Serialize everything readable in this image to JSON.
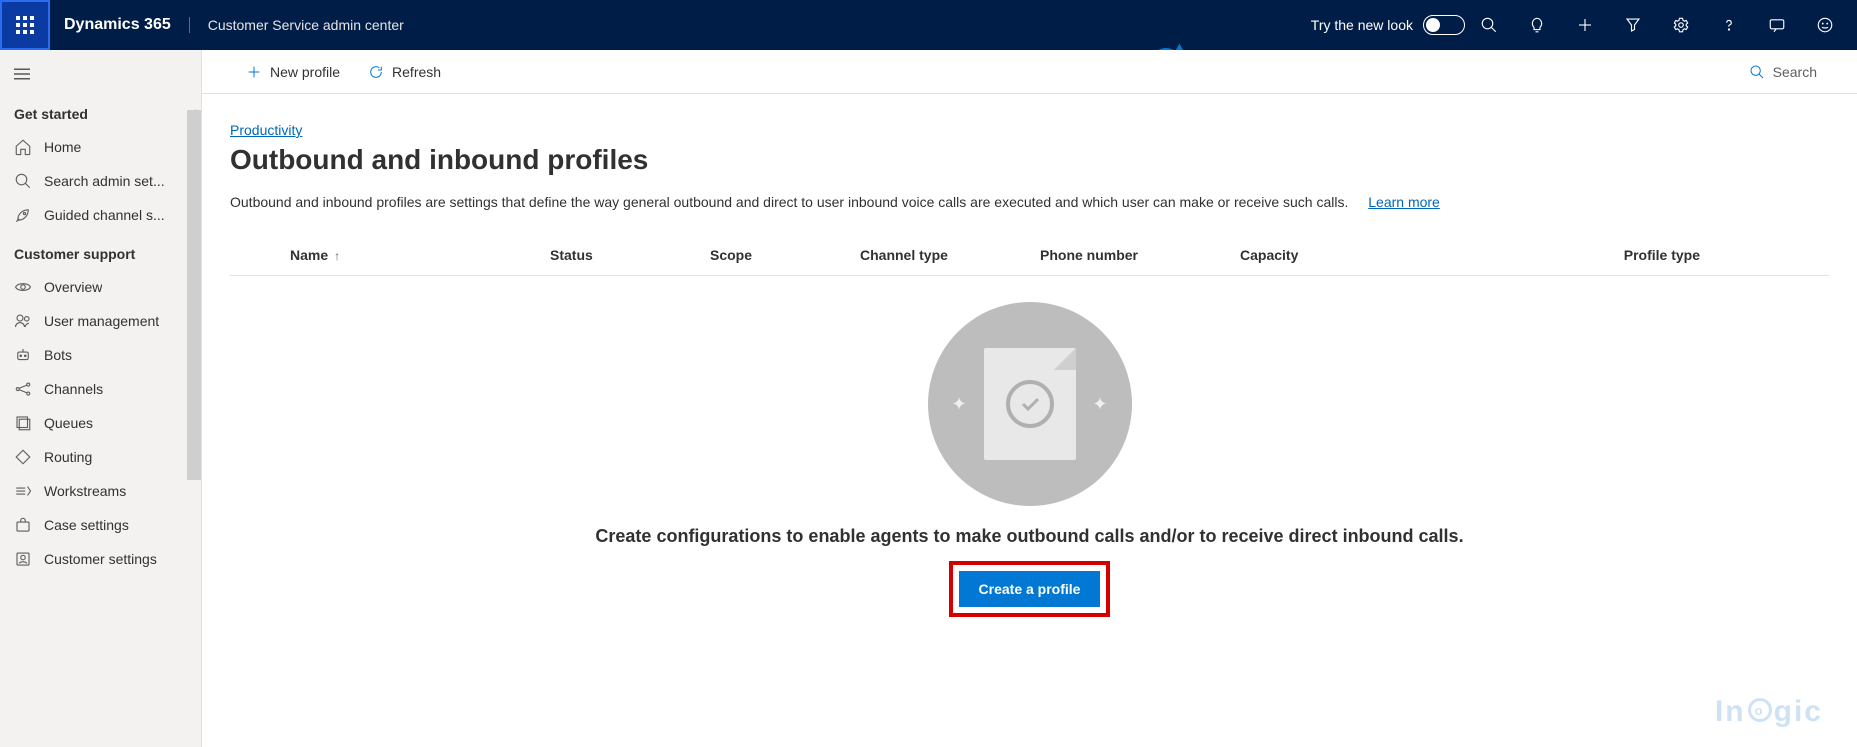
{
  "topbar": {
    "brand": "Dynamics 365",
    "subtitle": "Customer Service admin center",
    "try_label": "Try the new look",
    "toggle_on": false
  },
  "commandbar": {
    "new_profile": "New profile",
    "refresh": "Refresh",
    "search": "Search"
  },
  "leftnav": {
    "groups": [
      {
        "title": "Get started",
        "items": [
          {
            "icon": "home",
            "label": "Home"
          },
          {
            "icon": "search",
            "label": "Search admin set..."
          },
          {
            "icon": "rocket",
            "label": "Guided channel s..."
          }
        ]
      },
      {
        "title": "Customer support",
        "items": [
          {
            "icon": "eye",
            "label": "Overview"
          },
          {
            "icon": "users",
            "label": "User management"
          },
          {
            "icon": "bot",
            "label": "Bots"
          },
          {
            "icon": "channels",
            "label": "Channels"
          },
          {
            "icon": "queues",
            "label": "Queues"
          },
          {
            "icon": "routing",
            "label": "Routing"
          },
          {
            "icon": "workstreams",
            "label": "Workstreams"
          },
          {
            "icon": "case",
            "label": "Case settings"
          },
          {
            "icon": "customer",
            "label": "Customer settings"
          }
        ]
      }
    ]
  },
  "page": {
    "breadcrumb": "Productivity",
    "title": "Outbound and inbound profiles",
    "description": "Outbound and inbound profiles are settings that define the way general outbound and direct to user inbound voice calls are executed and which user can make or receive such calls.",
    "learn_more": "Learn more"
  },
  "table": {
    "columns": {
      "name": "Name",
      "status": "Status",
      "scope": "Scope",
      "channel_type": "Channel type",
      "phone_number": "Phone number",
      "capacity": "Capacity",
      "profile_type": "Profile type"
    },
    "sort_column": "name",
    "sort_dir": "asc",
    "rows": []
  },
  "empty_state": {
    "headline": "Create configurations to enable agents to make outbound calls and/or to receive direct inbound calls.",
    "button": "Create a profile"
  },
  "watermark": "Inogic"
}
